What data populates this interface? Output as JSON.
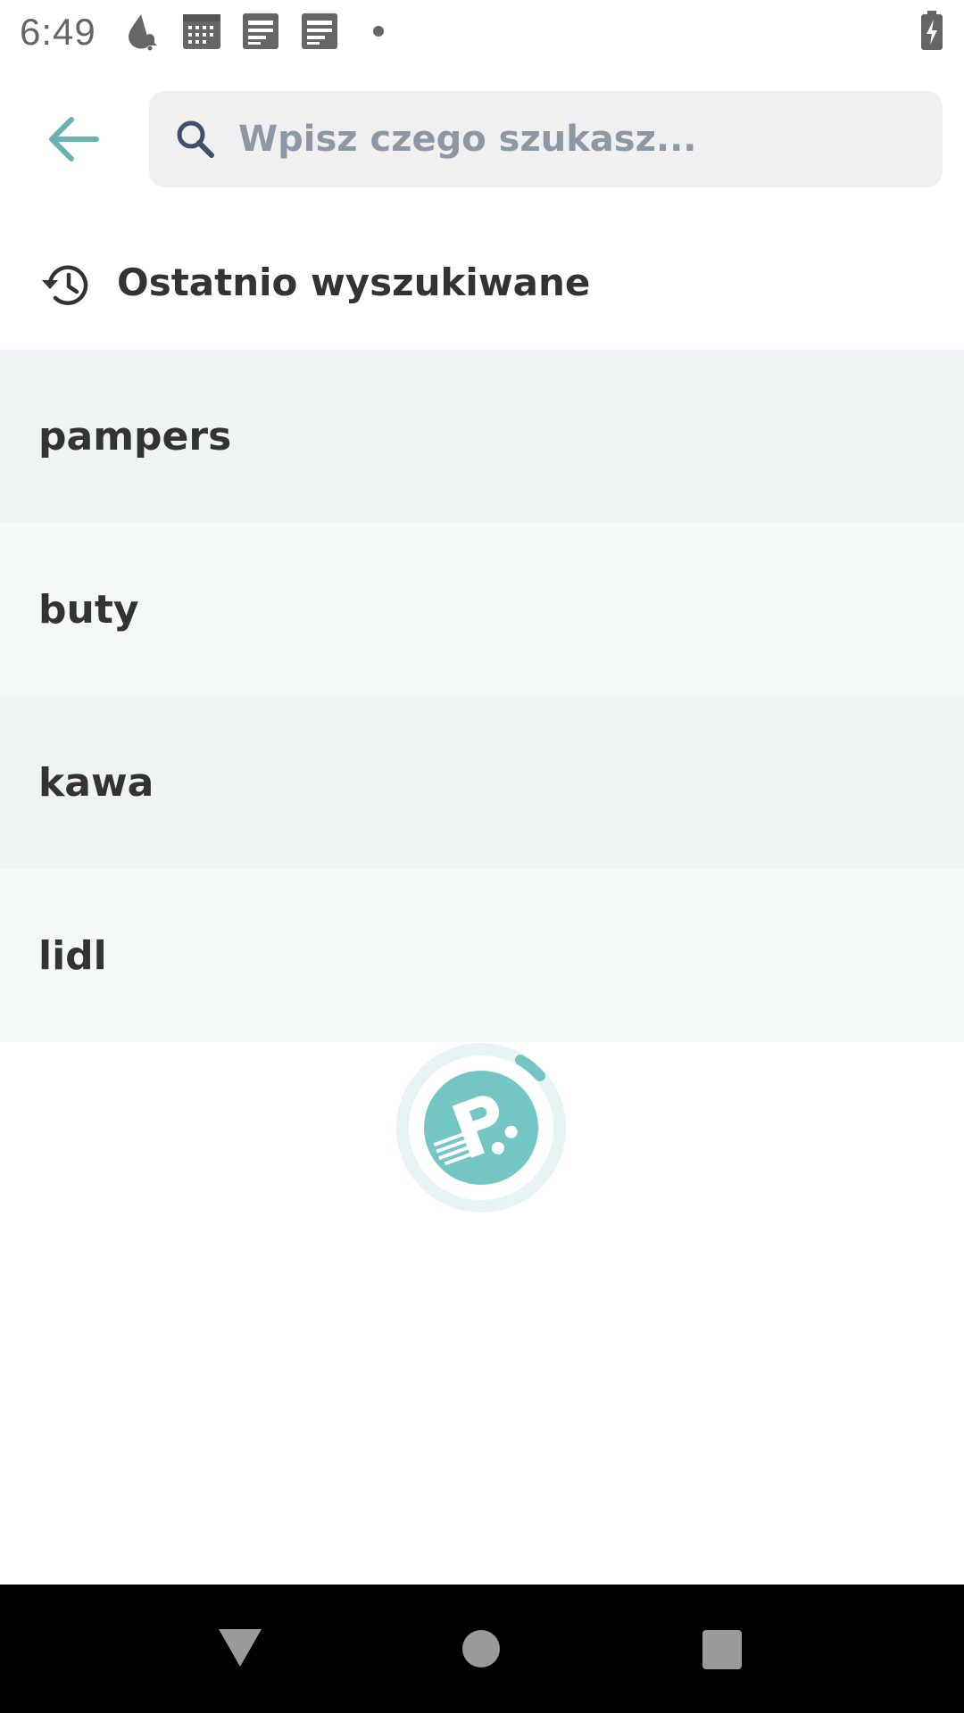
{
  "status_bar": {
    "time": "6:49",
    "icons": [
      "drop-bell-icon",
      "calendar-icon",
      "news-icon",
      "news-icon",
      "dot-icon",
      "battery-charging-icon"
    ]
  },
  "search": {
    "placeholder": "Wpisz czego szukasz...",
    "value": ""
  },
  "recent": {
    "title": "Ostatnio wyszukiwane",
    "items": [
      "pampers",
      "buty",
      "kawa",
      "lidl"
    ]
  },
  "colors": {
    "accent": "#74c6c4",
    "back_arrow": "#6ab3b3",
    "row_odd": "#eef3f4",
    "row_even": "#f5f8f9",
    "text": "#333333",
    "placeholder": "#8d98a6"
  },
  "nav": {
    "icons": [
      "back-triangle-icon",
      "home-circle-icon",
      "recents-square-icon"
    ]
  }
}
